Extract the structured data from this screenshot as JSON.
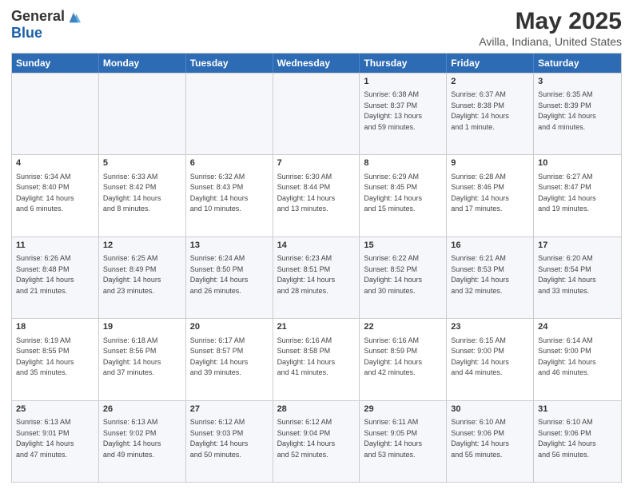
{
  "header": {
    "logo_general": "General",
    "logo_blue": "Blue",
    "title": "May 2025",
    "subtitle": "Avilla, Indiana, United States"
  },
  "calendar": {
    "days": [
      "Sunday",
      "Monday",
      "Tuesday",
      "Wednesday",
      "Thursday",
      "Friday",
      "Saturday"
    ],
    "rows": [
      [
        {
          "day": "",
          "info": ""
        },
        {
          "day": "",
          "info": ""
        },
        {
          "day": "",
          "info": ""
        },
        {
          "day": "",
          "info": ""
        },
        {
          "day": "1",
          "info": "Sunrise: 6:38 AM\nSunset: 8:37 PM\nDaylight: 13 hours\nand 59 minutes."
        },
        {
          "day": "2",
          "info": "Sunrise: 6:37 AM\nSunset: 8:38 PM\nDaylight: 14 hours\nand 1 minute."
        },
        {
          "day": "3",
          "info": "Sunrise: 6:35 AM\nSunset: 8:39 PM\nDaylight: 14 hours\nand 4 minutes."
        }
      ],
      [
        {
          "day": "4",
          "info": "Sunrise: 6:34 AM\nSunset: 8:40 PM\nDaylight: 14 hours\nand 6 minutes."
        },
        {
          "day": "5",
          "info": "Sunrise: 6:33 AM\nSunset: 8:42 PM\nDaylight: 14 hours\nand 8 minutes."
        },
        {
          "day": "6",
          "info": "Sunrise: 6:32 AM\nSunset: 8:43 PM\nDaylight: 14 hours\nand 10 minutes."
        },
        {
          "day": "7",
          "info": "Sunrise: 6:30 AM\nSunset: 8:44 PM\nDaylight: 14 hours\nand 13 minutes."
        },
        {
          "day": "8",
          "info": "Sunrise: 6:29 AM\nSunset: 8:45 PM\nDaylight: 14 hours\nand 15 minutes."
        },
        {
          "day": "9",
          "info": "Sunrise: 6:28 AM\nSunset: 8:46 PM\nDaylight: 14 hours\nand 17 minutes."
        },
        {
          "day": "10",
          "info": "Sunrise: 6:27 AM\nSunset: 8:47 PM\nDaylight: 14 hours\nand 19 minutes."
        }
      ],
      [
        {
          "day": "11",
          "info": "Sunrise: 6:26 AM\nSunset: 8:48 PM\nDaylight: 14 hours\nand 21 minutes."
        },
        {
          "day": "12",
          "info": "Sunrise: 6:25 AM\nSunset: 8:49 PM\nDaylight: 14 hours\nand 23 minutes."
        },
        {
          "day": "13",
          "info": "Sunrise: 6:24 AM\nSunset: 8:50 PM\nDaylight: 14 hours\nand 26 minutes."
        },
        {
          "day": "14",
          "info": "Sunrise: 6:23 AM\nSunset: 8:51 PM\nDaylight: 14 hours\nand 28 minutes."
        },
        {
          "day": "15",
          "info": "Sunrise: 6:22 AM\nSunset: 8:52 PM\nDaylight: 14 hours\nand 30 minutes."
        },
        {
          "day": "16",
          "info": "Sunrise: 6:21 AM\nSunset: 8:53 PM\nDaylight: 14 hours\nand 32 minutes."
        },
        {
          "day": "17",
          "info": "Sunrise: 6:20 AM\nSunset: 8:54 PM\nDaylight: 14 hours\nand 33 minutes."
        }
      ],
      [
        {
          "day": "18",
          "info": "Sunrise: 6:19 AM\nSunset: 8:55 PM\nDaylight: 14 hours\nand 35 minutes."
        },
        {
          "day": "19",
          "info": "Sunrise: 6:18 AM\nSunset: 8:56 PM\nDaylight: 14 hours\nand 37 minutes."
        },
        {
          "day": "20",
          "info": "Sunrise: 6:17 AM\nSunset: 8:57 PM\nDaylight: 14 hours\nand 39 minutes."
        },
        {
          "day": "21",
          "info": "Sunrise: 6:16 AM\nSunset: 8:58 PM\nDaylight: 14 hours\nand 41 minutes."
        },
        {
          "day": "22",
          "info": "Sunrise: 6:16 AM\nSunset: 8:59 PM\nDaylight: 14 hours\nand 42 minutes."
        },
        {
          "day": "23",
          "info": "Sunrise: 6:15 AM\nSunset: 9:00 PM\nDaylight: 14 hours\nand 44 minutes."
        },
        {
          "day": "24",
          "info": "Sunrise: 6:14 AM\nSunset: 9:00 PM\nDaylight: 14 hours\nand 46 minutes."
        }
      ],
      [
        {
          "day": "25",
          "info": "Sunrise: 6:13 AM\nSunset: 9:01 PM\nDaylight: 14 hours\nand 47 minutes."
        },
        {
          "day": "26",
          "info": "Sunrise: 6:13 AM\nSunset: 9:02 PM\nDaylight: 14 hours\nand 49 minutes."
        },
        {
          "day": "27",
          "info": "Sunrise: 6:12 AM\nSunset: 9:03 PM\nDaylight: 14 hours\nand 50 minutes."
        },
        {
          "day": "28",
          "info": "Sunrise: 6:12 AM\nSunset: 9:04 PM\nDaylight: 14 hours\nand 52 minutes."
        },
        {
          "day": "29",
          "info": "Sunrise: 6:11 AM\nSunset: 9:05 PM\nDaylight: 14 hours\nand 53 minutes."
        },
        {
          "day": "30",
          "info": "Sunrise: 6:10 AM\nSunset: 9:06 PM\nDaylight: 14 hours\nand 55 minutes."
        },
        {
          "day": "31",
          "info": "Sunrise: 6:10 AM\nSunset: 9:06 PM\nDaylight: 14 hours\nand 56 minutes."
        }
      ]
    ]
  }
}
